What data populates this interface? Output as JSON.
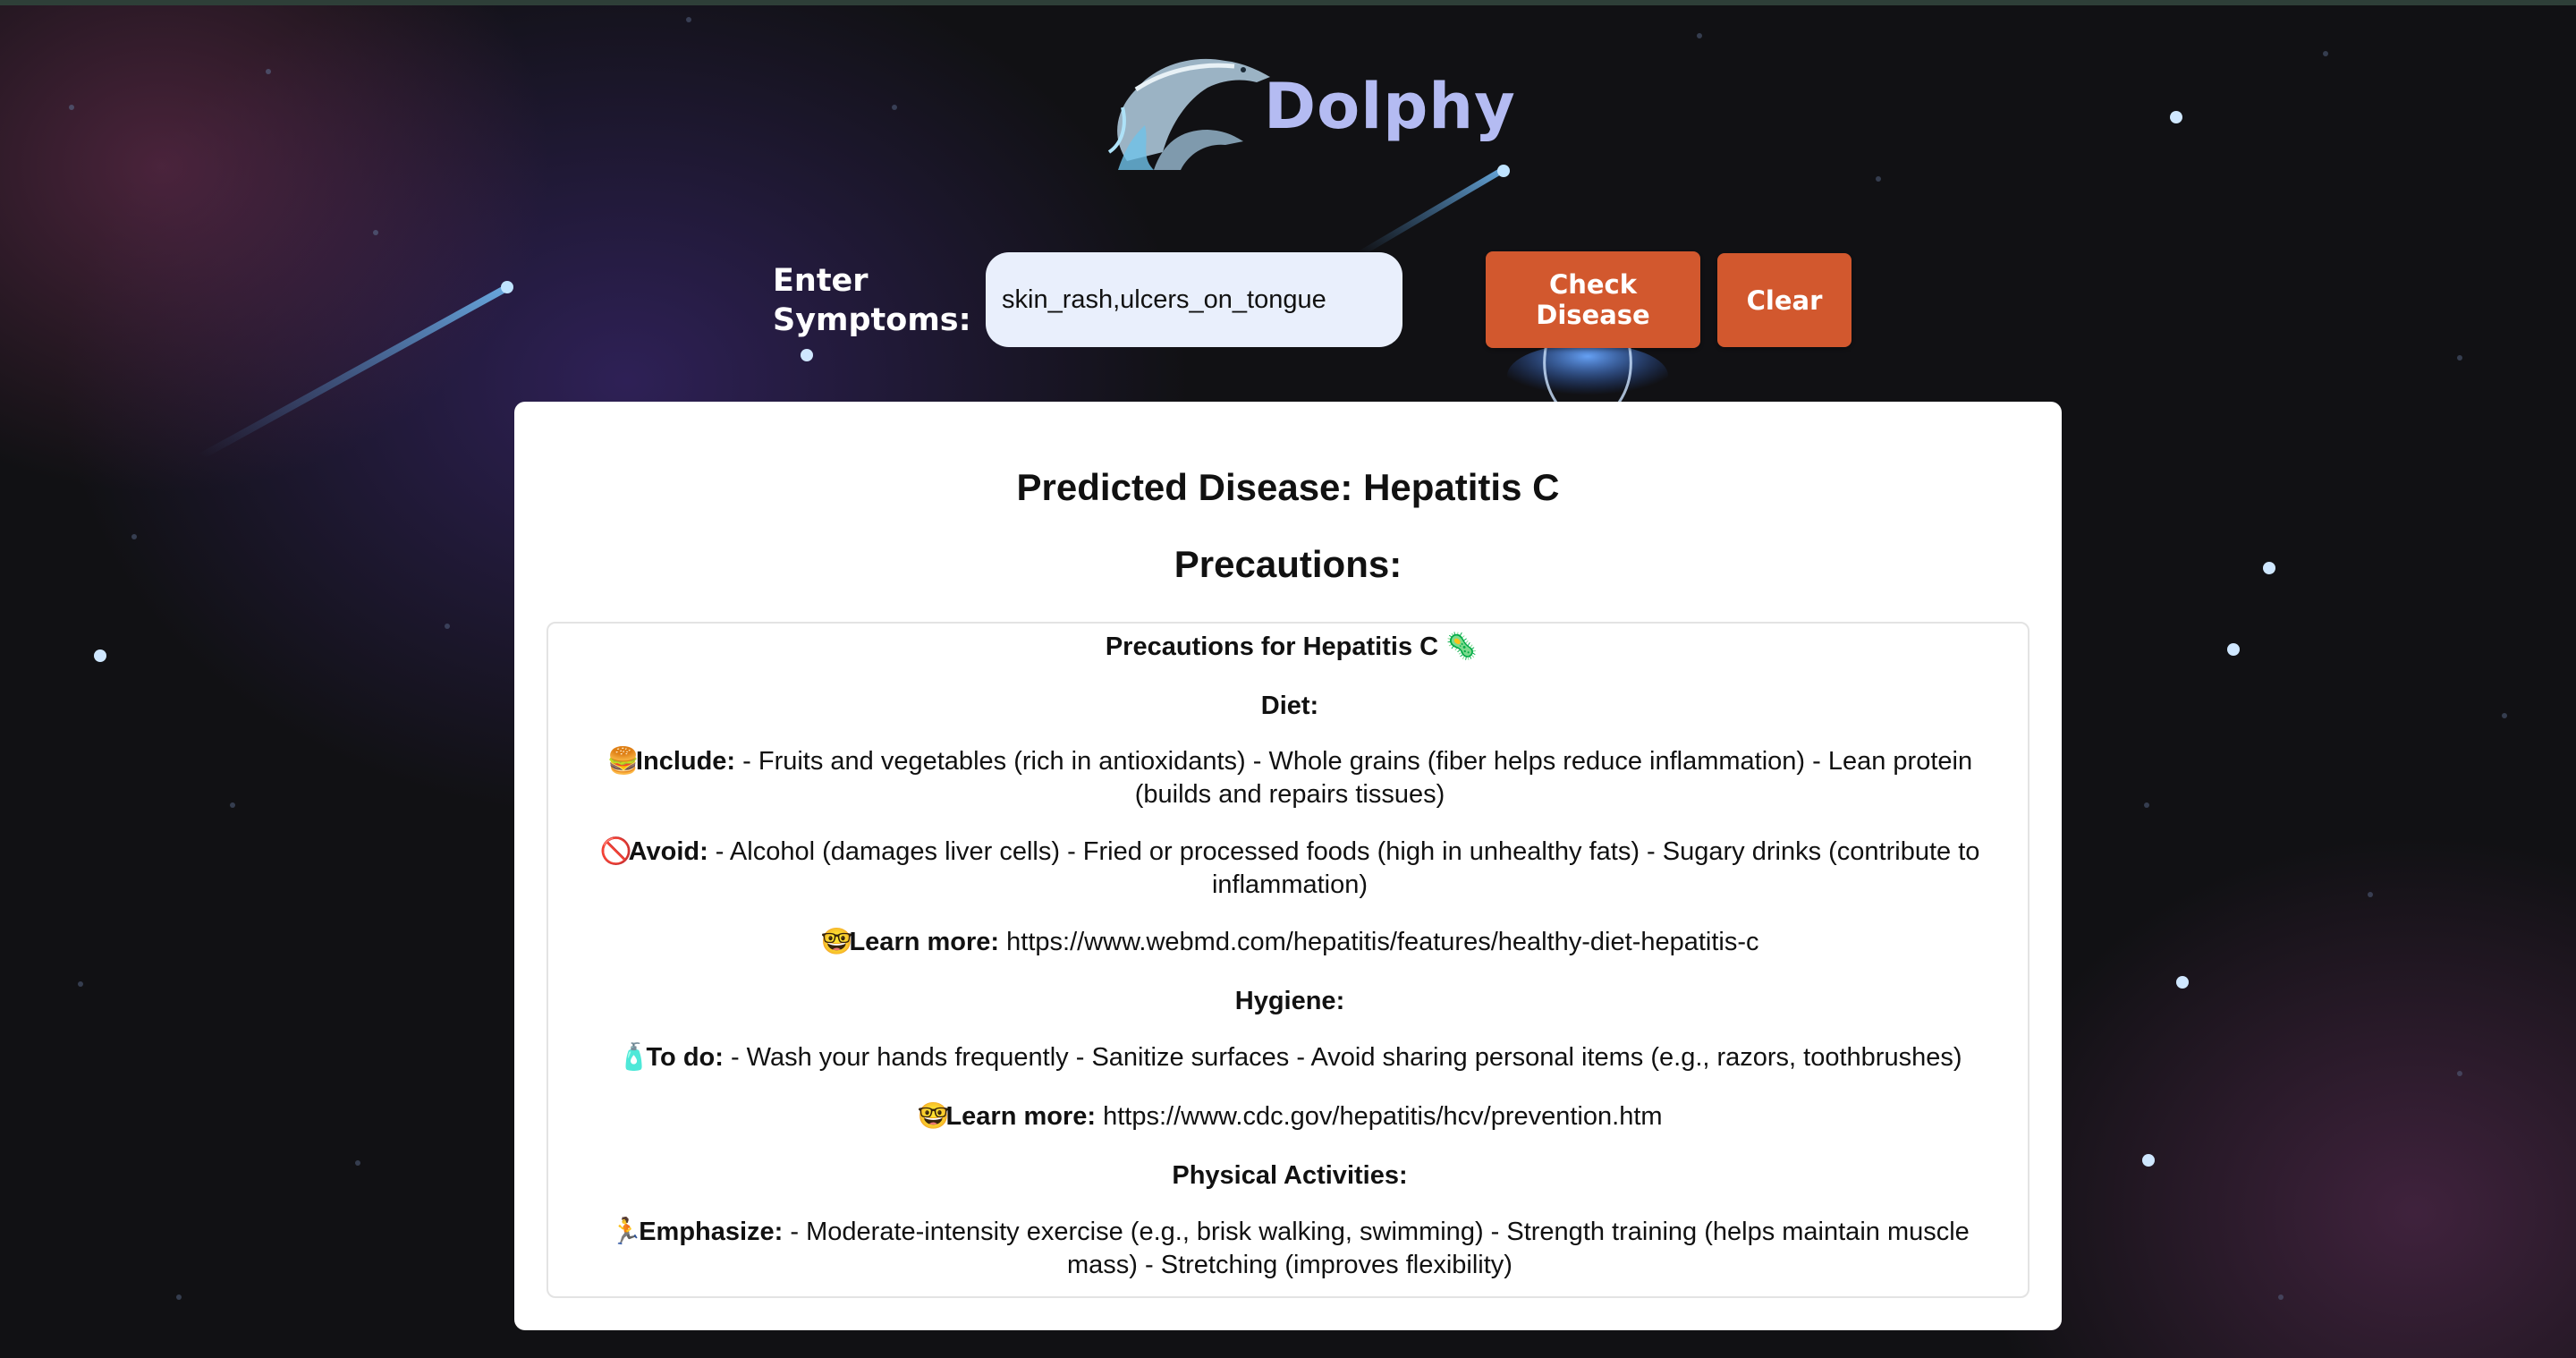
{
  "app": {
    "brand": "Dolphy",
    "logo_icon": "dolphin-logo-icon"
  },
  "form": {
    "label_line1": "Enter",
    "label_line2": "Symptoms:",
    "input_value": "skin_rash,ulcers_on_tongue",
    "check_line1": "Check",
    "check_line2": "Disease",
    "clear_label": "Clear"
  },
  "result": {
    "title": "Predicted Disease: Hepatitis C",
    "subtitle": "Precautions:",
    "precautions": {
      "heading": "Precautions for Hepatitis C",
      "heading_icon": "🦠",
      "diet_heading": "Diet:",
      "include_icon": "🍔",
      "include_label": "Include:",
      "include_text_1": " - Fruits and vegetables (rich in antioxidants) - Whole grains (fiber helps reduce inflammation) - Lean protein",
      "include_text_2": "(builds and repairs tissues)",
      "avoid_icon": "🚫",
      "avoid_label": "Avoid:",
      "avoid_text_1": " - Alcohol (damages liver cells) - Fried or processed foods (high in unhealthy fats) - Sugary drinks (contribute to",
      "avoid_text_2": "inflammation)",
      "learn_icon": "🤓",
      "learn_label": "Learn more:",
      "diet_url": " https://www.webmd.com/hepatitis/features/healthy-diet-hepatitis-c",
      "hygiene_heading": "Hygiene:",
      "todo_icon": "🧴",
      "todo_label": "To do:",
      "todo_text": " - Wash your hands frequently - Sanitize surfaces - Avoid sharing personal items (e.g., razors, toothbrushes)",
      "hygiene_url": " https://www.cdc.gov/hepatitis/hcv/prevention.htm",
      "activities_heading": "Physical Activities:",
      "emph_icon": "🏃",
      "emph_label": "Emphasize:",
      "emph_text_1": " - Moderate-intensity exercise (e.g., brisk walking, swimming) - Strength training (helps maintain muscle",
      "emph_text_2": "mass) - Stretching (improves flexibility)"
    }
  },
  "colors": {
    "accent": "#d2582e",
    "brand": "#b4bbf2",
    "input_bg": "#e9effc"
  }
}
